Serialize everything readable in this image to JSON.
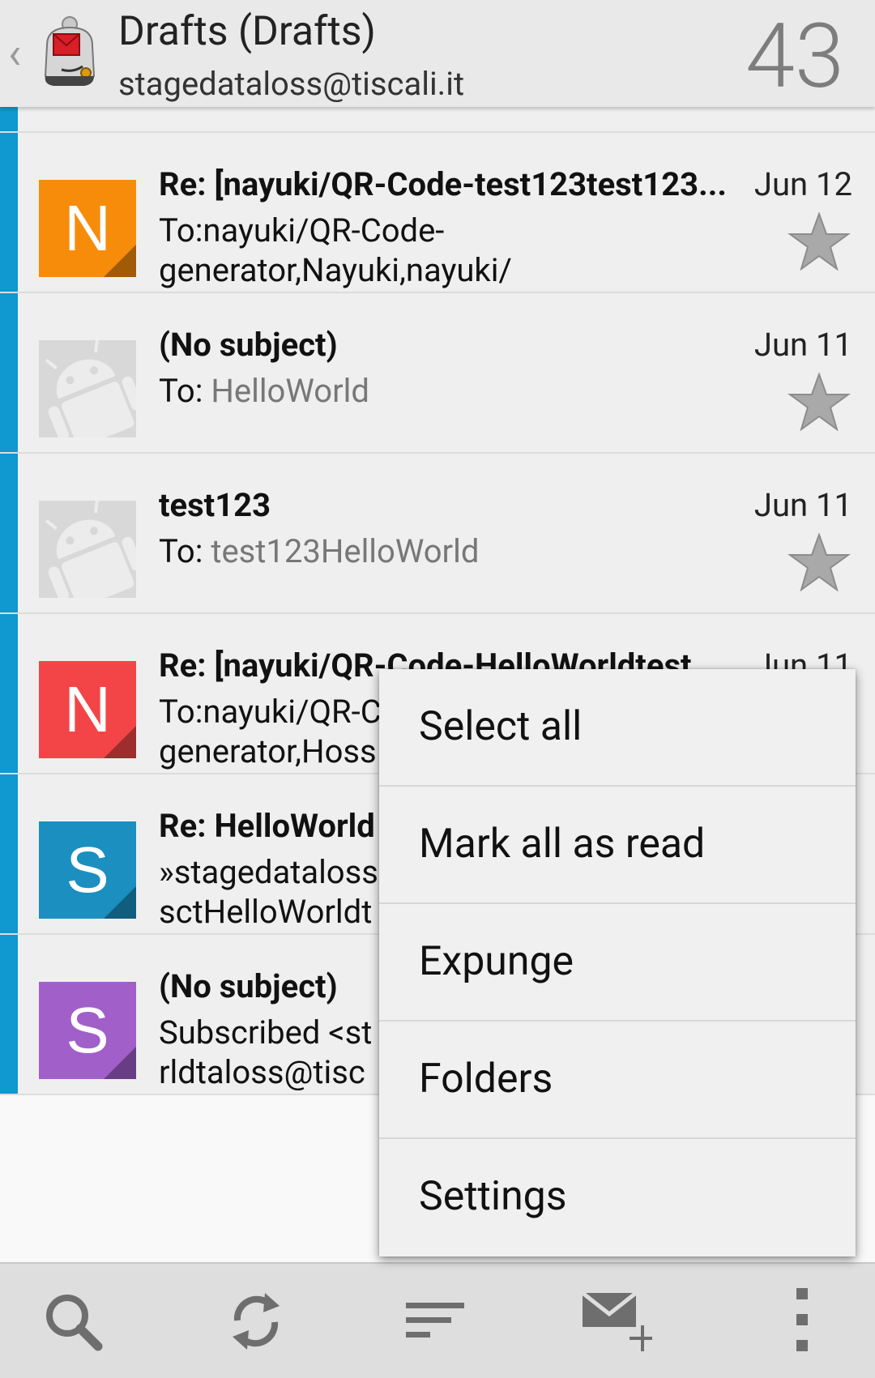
{
  "header": {
    "folder_title": "Drafts (Drafts)",
    "account_email": "stagedataloss@tiscali.it",
    "unread_count": "43",
    "back_icon": "chevron-left-icon",
    "logo_icon": "k9-mail-logo-icon"
  },
  "messages": [
    {
      "avatar_letter": "N",
      "avatar_color": "#f78c0b",
      "subject": "Re: [nayuki/QR-Code-test123test123...",
      "date": "Jun 12",
      "preview_prefix": "To:nayuki/QR-Code-\ngenerator,Nayuki,nayuki/",
      "preview_value": ""
    },
    {
      "avatar_letter": "",
      "avatar_color": "#d8d8d8",
      "subject": "(No subject)",
      "date": "Jun 11",
      "preview_prefix": "To: ",
      "preview_value": "HelloWorld"
    },
    {
      "avatar_letter": "",
      "avatar_color": "#d8d8d8",
      "subject": "test123",
      "date": "Jun 11",
      "preview_prefix": "To: ",
      "preview_value": "test123HelloWorld"
    },
    {
      "avatar_letter": "N",
      "avatar_color": "#f34547",
      "subject": "Re: [nayuki/QR-Code-HelloWorldtest...",
      "date": "Jun 11",
      "preview_prefix": "To:nayuki/QR-C\ngenerator,Hoss",
      "preview_value": ""
    },
    {
      "avatar_letter": "S",
      "avatar_color": "#1a8fc0",
      "subject": "Re: HelloWorld",
      "date": "",
      "preview_prefix": "»stagedataloss\nsctHelloWorldt",
      "preview_value": ""
    },
    {
      "avatar_letter": "S",
      "avatar_color": "#a15fc9",
      "subject": "(No subject)",
      "date": "",
      "preview_prefix": "Subscribed <st\nrldtaloss@tisc",
      "preview_value": ""
    }
  ],
  "menu": {
    "items": [
      "Select all",
      "Mark all as read",
      "Expunge",
      "Folders",
      "Settings"
    ]
  },
  "bottom_bar": {
    "icons": [
      "search-icon",
      "refresh-icon",
      "sort-icon",
      "compose-icon",
      "overflow-menu-icon"
    ]
  },
  "colors": {
    "accent_bar": "#1098d1",
    "header_bg": "#e9e9e9",
    "row_bg": "#efefef",
    "star": "#a8a8a8"
  }
}
